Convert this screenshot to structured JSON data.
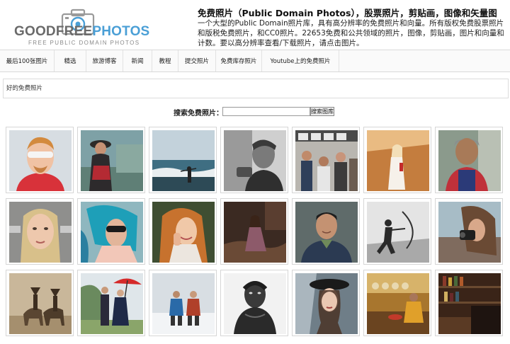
{
  "header": {
    "logo": {
      "brand_part1": "GOODFREE",
      "brand_part2": "PHOTOS",
      "tagline": "FREE PUBLIC DOMAIN PHOTOS",
      "icon": "camera-icon"
    },
    "intro_title": "免费照片（Public Domain Photos），股票照片，剪贴画，图像和矢量图",
    "intro_text": "一个大型的Public Domain照片库，具有高分辨率的免费照片和向量。所有版权免费股票照片和版税免费照片，和CC0照片。22653免费和公共领域的照片，图像，剪贴画，图片和向量和计数。要以高分辨率查看/下载照片，请点击图片。"
  },
  "nav": {
    "items": [
      {
        "label": "最后100张图片"
      },
      {
        "label": "精选"
      },
      {
        "label": "旅游博客"
      },
      {
        "label": "新闻"
      },
      {
        "label": "教程"
      },
      {
        "label": "提交照片"
      },
      {
        "label": "免费库存照片"
      },
      {
        "label": "Youtube上的免费照片"
      }
    ]
  },
  "breadcrumb": {
    "text": "好的免费照片"
  },
  "search": {
    "label": "搜索免费照片：",
    "value": "",
    "button_label": "搜索图库"
  },
  "photos": {
    "rows": [
      [
        "man-with-white-sunglasses",
        "woman-hat-red-dress",
        "ocean-waves-shore",
        "man-black-and-white",
        "people-in-bus",
        "girl-in-golden-field",
        "old-woman-smiling"
      ],
      [
        "woman-close-portrait",
        "blue-haired-woman",
        "woman-laughing",
        "woman-sitting-rocks",
        "asian-man-smiling",
        "archer-black-and-white",
        "girl-with-camera"
      ],
      [
        "native-riders-sepia",
        "couple-red-umbrella",
        "people-in-snow",
        "man-mud-portrait",
        "woman-black-hat",
        "chef-in-kitchen",
        "bar-shelves"
      ]
    ]
  },
  "colors": {
    "brand_gray": "#6a6a6a",
    "brand_blue": "#4a9fd6"
  }
}
